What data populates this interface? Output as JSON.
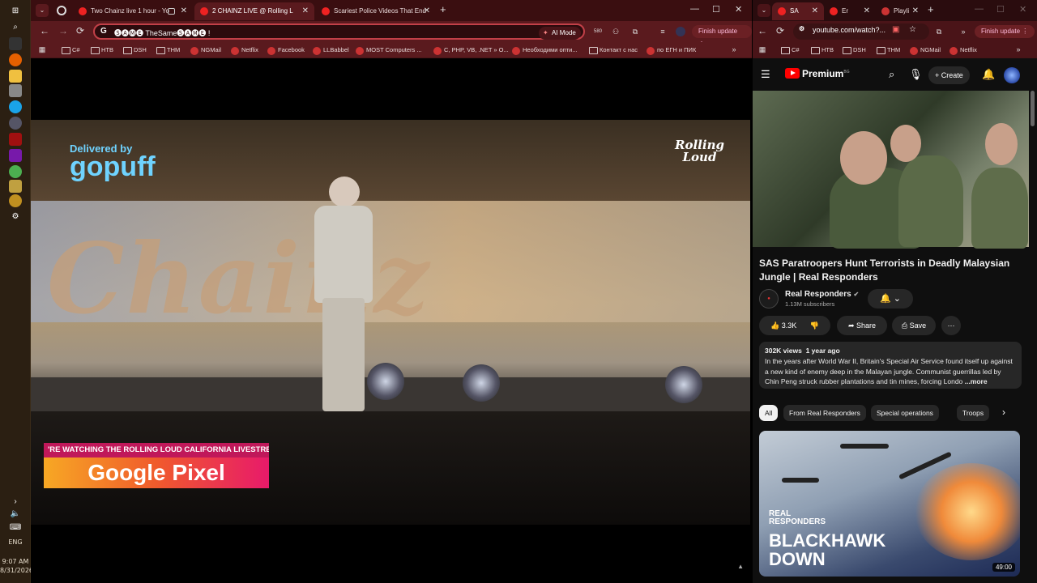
{
  "taskbar": {
    "language": "ENG",
    "time": "9:07 AM",
    "date": "8/31/2026"
  },
  "left_window": {
    "tabs": [
      {
        "title": "Two Chainz live 1 hour - Yo"
      },
      {
        "title": "2 CHAINZ LIVE @ Rolling L"
      },
      {
        "title": "Scariest Police Videos That End"
      }
    ],
    "address": "🅢🅐🅜🅔 TheSame🅢🅐🅜🅔 !",
    "ai_mode": "AI Mode",
    "badge": "580",
    "finish_update": "Finish update",
    "bookmarks": [
      "C#",
      "НТВ",
      "DSH",
      "THM",
      "NGMail",
      "Netflix",
      "Facebook",
      "LLBabbel",
      "MOST Computers ...",
      "C, PHP, VB, .NET » O...",
      "Необходими опти...",
      "Контакт с нас",
      "по ЕГН и ПИК"
    ],
    "video": {
      "sponsor_line1": "Delivered by",
      "sponsor_line2": "gopuff",
      "screen_text": "Chainz",
      "logo_line1": "Rolling",
      "logo_line2": "Loud",
      "lower_third_top": "'RE WATCHING THE ROLLING LOUD CALIFORNIA LIVESTREAM PRESENTED BY",
      "lower_third_bottom": "Google Pixel"
    }
  },
  "right_window": {
    "tabs": [
      {
        "title": "SA"
      },
      {
        "title": "Er"
      },
      {
        "title": "Playli"
      }
    ],
    "address": "youtube.com/watch?...",
    "finish_update": "Finish update",
    "bookmarks": [
      "C#",
      "НТВ",
      "DSH",
      "THM",
      "NGMail",
      "Netflix"
    ],
    "youtube": {
      "logo": "Premium",
      "logo_sup": "BG",
      "create": "Create",
      "video_title": "SAS Paratroopers Hunt Terrorists in Deadly Malaysian Jungle | Real Responders",
      "channel_name": "Real Responders",
      "subscribers": "1.13M subscribers",
      "likes": "3.3K",
      "share": "Share",
      "save": "Save",
      "views": "302K views",
      "age": "1 year ago",
      "description": "In the years after World War II, Britain's Special Air Service found itself up against a new kind of enemy deep in the Malayan jungle. Communist guerrillas led by Chin Peng struck rubber plantations and tin mines, forcing Londo",
      "more": "...more",
      "chips": [
        "All",
        "From Real Responders",
        "Special operations",
        "Troops"
      ],
      "next_video": {
        "brand_line1": "REAL",
        "brand_line2": "RESPONDERS",
        "title_line1": "BLACKHAWK",
        "title_line2": "DOWN",
        "duration": "49:00"
      }
    }
  }
}
